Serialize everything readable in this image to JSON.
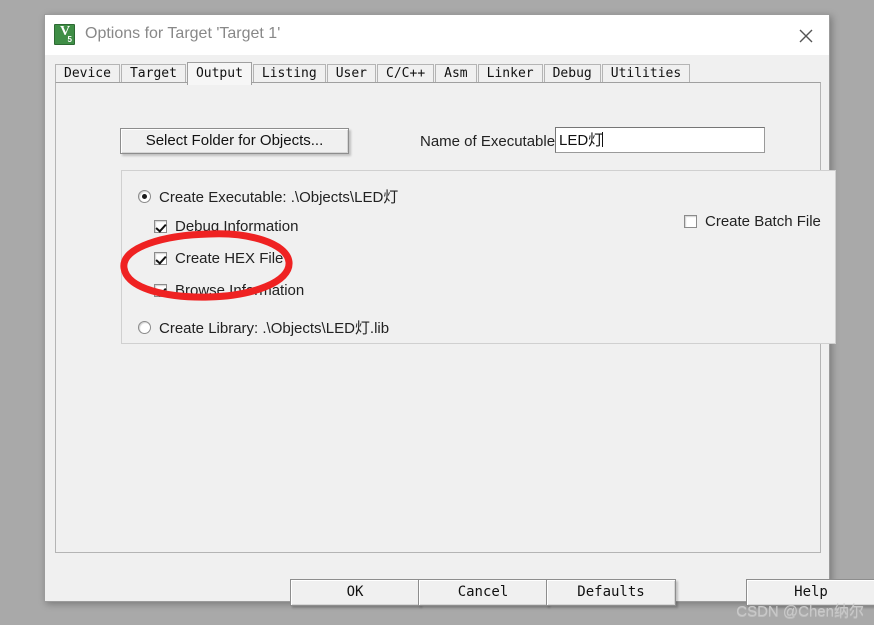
{
  "window": {
    "title": "Options for Target 'Target 1'",
    "icon": "keil-uvision-icon",
    "close_icon": "close-icon",
    "background_color": "#a9a9a9",
    "dialog_color": "#f0f0f0"
  },
  "tabs": [
    {
      "label": "Device",
      "active": false
    },
    {
      "label": "Target",
      "active": false
    },
    {
      "label": "Output",
      "active": true
    },
    {
      "label": "Listing",
      "active": false
    },
    {
      "label": "User",
      "active": false
    },
    {
      "label": "C/C++",
      "active": false
    },
    {
      "label": "Asm",
      "active": false
    },
    {
      "label": "Linker",
      "active": false
    },
    {
      "label": "Debug",
      "active": false
    },
    {
      "label": "Utilities",
      "active": false
    }
  ],
  "output_tab": {
    "select_folder_button": "Select Folder for Objects...",
    "executable_label": "Name of Executable:",
    "executable_value": "LED灯",
    "executable_placeholder": "",
    "create_executable": {
      "label": "Create Executable:  .\\Objects\\LED灯",
      "selected": true
    },
    "debug_information": {
      "label": "Debug Information",
      "checked": true
    },
    "create_hex_file": {
      "label": "Create HEX File",
      "checked": true
    },
    "browse_information": {
      "label": "Browse Information",
      "checked": true
    },
    "create_library": {
      "label": "Create Library:  .\\Objects\\LED灯.lib",
      "selected": false
    },
    "create_batch_file": {
      "label": "Create Batch File",
      "checked": false
    }
  },
  "buttons": {
    "ok": "OK",
    "cancel": "Cancel",
    "defaults": "Defaults",
    "help": "Help"
  },
  "annotation": {
    "shape": "red-ellipse-highlight",
    "color": "#ef2222",
    "targets": "create_hex_file"
  },
  "watermark": "CSDN @Chen纳尔"
}
